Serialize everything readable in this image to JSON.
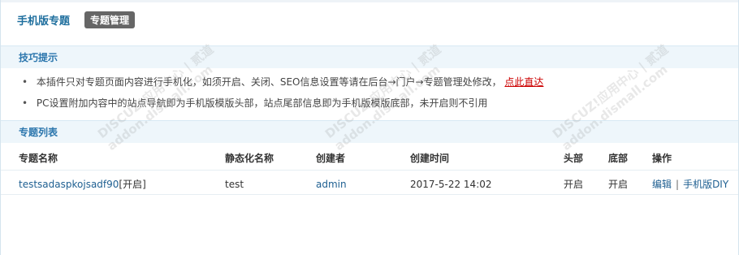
{
  "header": {
    "title": "手机版专题",
    "badge": "专题管理"
  },
  "tips": {
    "title": "技巧提示",
    "items": [
      {
        "text": "本插件只对专题页面内容进行手机化，如须开启、关闭、SEO信息设置等请在后台→门户→专题管理处修改，",
        "link": "点此直达"
      },
      {
        "text": "PC设置附加内容中的站点导航即为手机版模版头部，站点尾部信息即为手机版模版底部，未开启则不引用",
        "link": ""
      }
    ]
  },
  "list": {
    "title": "专题列表",
    "columns": [
      "专题名称",
      "静态化名称",
      "创建者",
      "创建时间",
      "头部",
      "底部",
      "操作"
    ],
    "rows": [
      {
        "name": "testsadaspkojsadf90",
        "status": "[开启]",
        "static_name": "test",
        "creator": "admin",
        "created_at": "2017-5-22 14:02",
        "header": "开启",
        "footer": "开启",
        "op_edit": "编辑",
        "op_separator": "|",
        "op_diy": "手机版DIY"
      }
    ]
  },
  "watermark": {
    "brand": "DISCUZ!应用中心 | 贰道",
    "url": "addon.dismall.com"
  }
}
